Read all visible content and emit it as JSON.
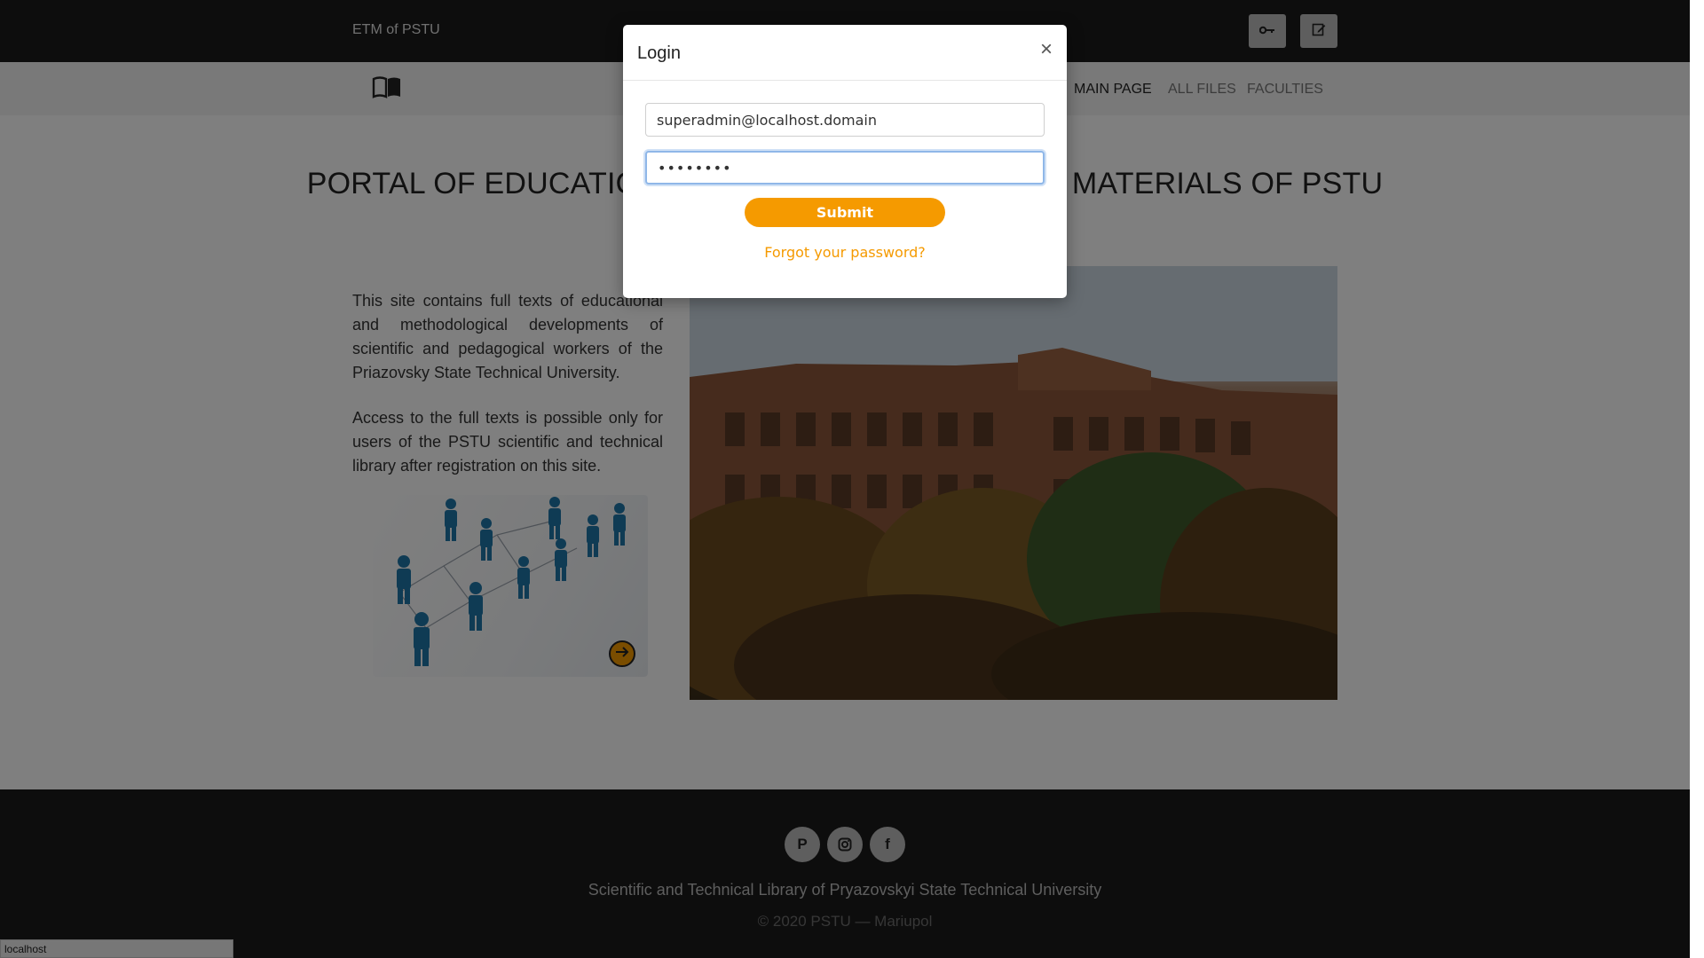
{
  "header": {
    "brand": "ETM of PSTU",
    "buttons": [
      {
        "icon": "key-icon"
      },
      {
        "icon": "edit-icon"
      }
    ]
  },
  "nav": {
    "logo_icon": "book-icon",
    "links": [
      {
        "label": "MAIN PAGE",
        "active": true
      },
      {
        "label": "ALL FILES",
        "active": false
      },
      {
        "label": "FACULTIES",
        "active": false
      }
    ]
  },
  "hero": {
    "title": "PORTAL OF EDUCATIONAL AND METHODOLOGICAL MATERIALS OF PSTU"
  },
  "intro": {
    "paragraph1": "This site contains full texts of educational and methodological developments of scientific and pedagogical workers of the Priazovsky State Technical University.",
    "paragraph2": "Access to the full texts is possible only for users of the PSTU scientific and technical library after registration on this site."
  },
  "footer": {
    "social": [
      {
        "icon": "p-icon",
        "glyph": "P"
      },
      {
        "icon": "instagram-icon",
        "glyph": ""
      },
      {
        "icon": "facebook-icon",
        "glyph": "f"
      }
    ],
    "line1": "Scientific and Technical Library of Pryazovskyi State Technical University",
    "line2": "© 2020 PSTU — Mariupol"
  },
  "status": {
    "url": "localhost"
  },
  "modal": {
    "title": "Login",
    "close": "×",
    "email_value": "superadmin@localhost.domain",
    "password_value": "••••••••",
    "submit": "Submit",
    "forgot": "Forgot your password?"
  },
  "colors": {
    "accent": "#f59a00",
    "topbar": "#1a1a1a",
    "navbar": "#f2f2f2"
  }
}
